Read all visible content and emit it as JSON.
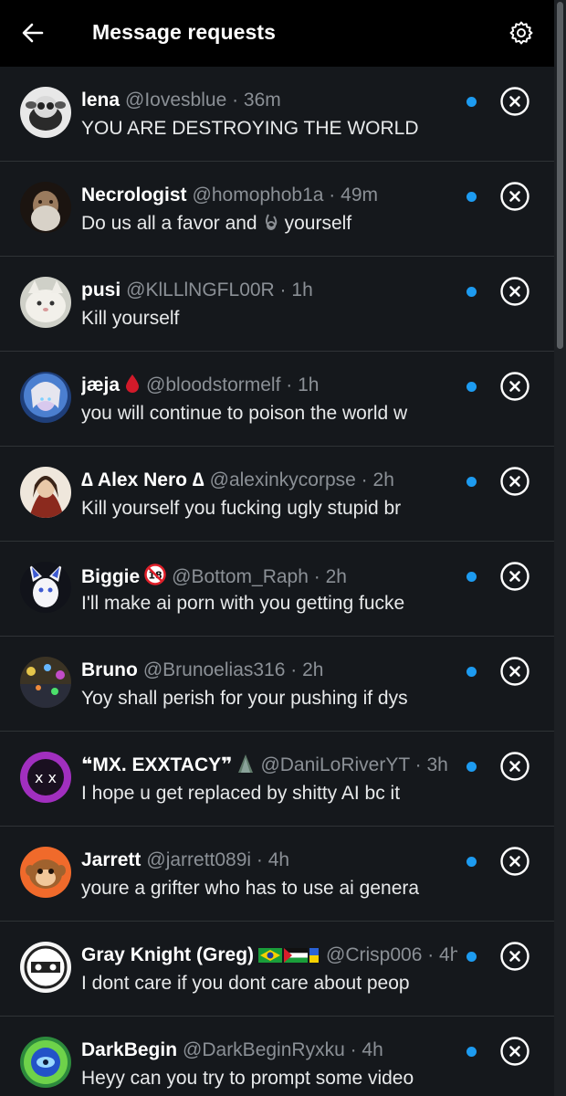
{
  "header": {
    "title": "Message requests",
    "back_icon": "arrow-left-icon",
    "settings_icon": "gear-icon"
  },
  "colors": {
    "background": "#15181c",
    "header": "#000000",
    "unread": "#1d9bf0",
    "muted": "#8b9096",
    "divider": "#2f3336"
  },
  "requests": [
    {
      "name": "lena",
      "badge": "",
      "handle": "@Iovesblue",
      "time": "36m",
      "message": "YOU ARE DESTROYING THE WORLD",
      "message_before_icon": "",
      "message_after_icon": ""
    },
    {
      "name": "Necrologist",
      "badge": "",
      "handle": "@homophob1a",
      "time": "49m",
      "message": "",
      "message_before_icon": "Do us all a favor and",
      "message_after_icon": "yourself"
    },
    {
      "name": "pusi",
      "badge": "",
      "handle": "@KlLLlNGFL00R",
      "time": "1h",
      "message": "Kill yourself",
      "message_before_icon": "",
      "message_after_icon": ""
    },
    {
      "name": "jæja",
      "badge": "blood-drop-icon",
      "handle": "@bloodstormelf",
      "time": "1h",
      "message": "you will continue to poison the world w",
      "message_before_icon": "",
      "message_after_icon": ""
    },
    {
      "name": "∆ Alex Nero ∆",
      "badge": "",
      "handle": "@alexinkycorpse",
      "time": "2h",
      "message": "Kill yourself you fucking ugly stupid br",
      "message_before_icon": "",
      "message_after_icon": ""
    },
    {
      "name": "Biggie",
      "badge": "no-under-18-icon",
      "handle": "@Bottom_Raph",
      "time": "2h",
      "message": "I'll make ai porn with you getting fucke",
      "message_before_icon": "",
      "message_after_icon": ""
    },
    {
      "name": "Bruno",
      "badge": "",
      "handle": "@Brunoelias316",
      "time": "2h",
      "message": "Yoy shall perish for your pushing if dys",
      "message_before_icon": "",
      "message_after_icon": ""
    },
    {
      "name": "❝MX. EXXTACY❞",
      "badge": "tree-icon",
      "handle": "@DaniLoRiverYT",
      "time": "3h",
      "message": "I hope u get replaced by shitty AI bc it",
      "message_before_icon": "",
      "message_after_icon": ""
    },
    {
      "name": "Jarrett",
      "badge": "",
      "handle": "@jarrett089i",
      "time": "4h",
      "message": "youre a grifter who has to use ai genera",
      "message_before_icon": "",
      "message_after_icon": ""
    },
    {
      "name": "Gray Knight (Greg)",
      "badge": "flags-icon",
      "handle": "@Crisp006",
      "time": "4h",
      "message": "I dont care if you dont care about peop",
      "message_before_icon": "",
      "message_after_icon": ""
    },
    {
      "name": "DarkBegin",
      "badge": "",
      "handle": "@DarkBeginRyxku",
      "time": "4h",
      "message": "Heyy can you try to prompt some video",
      "message_before_icon": "",
      "message_after_icon": ""
    }
  ]
}
